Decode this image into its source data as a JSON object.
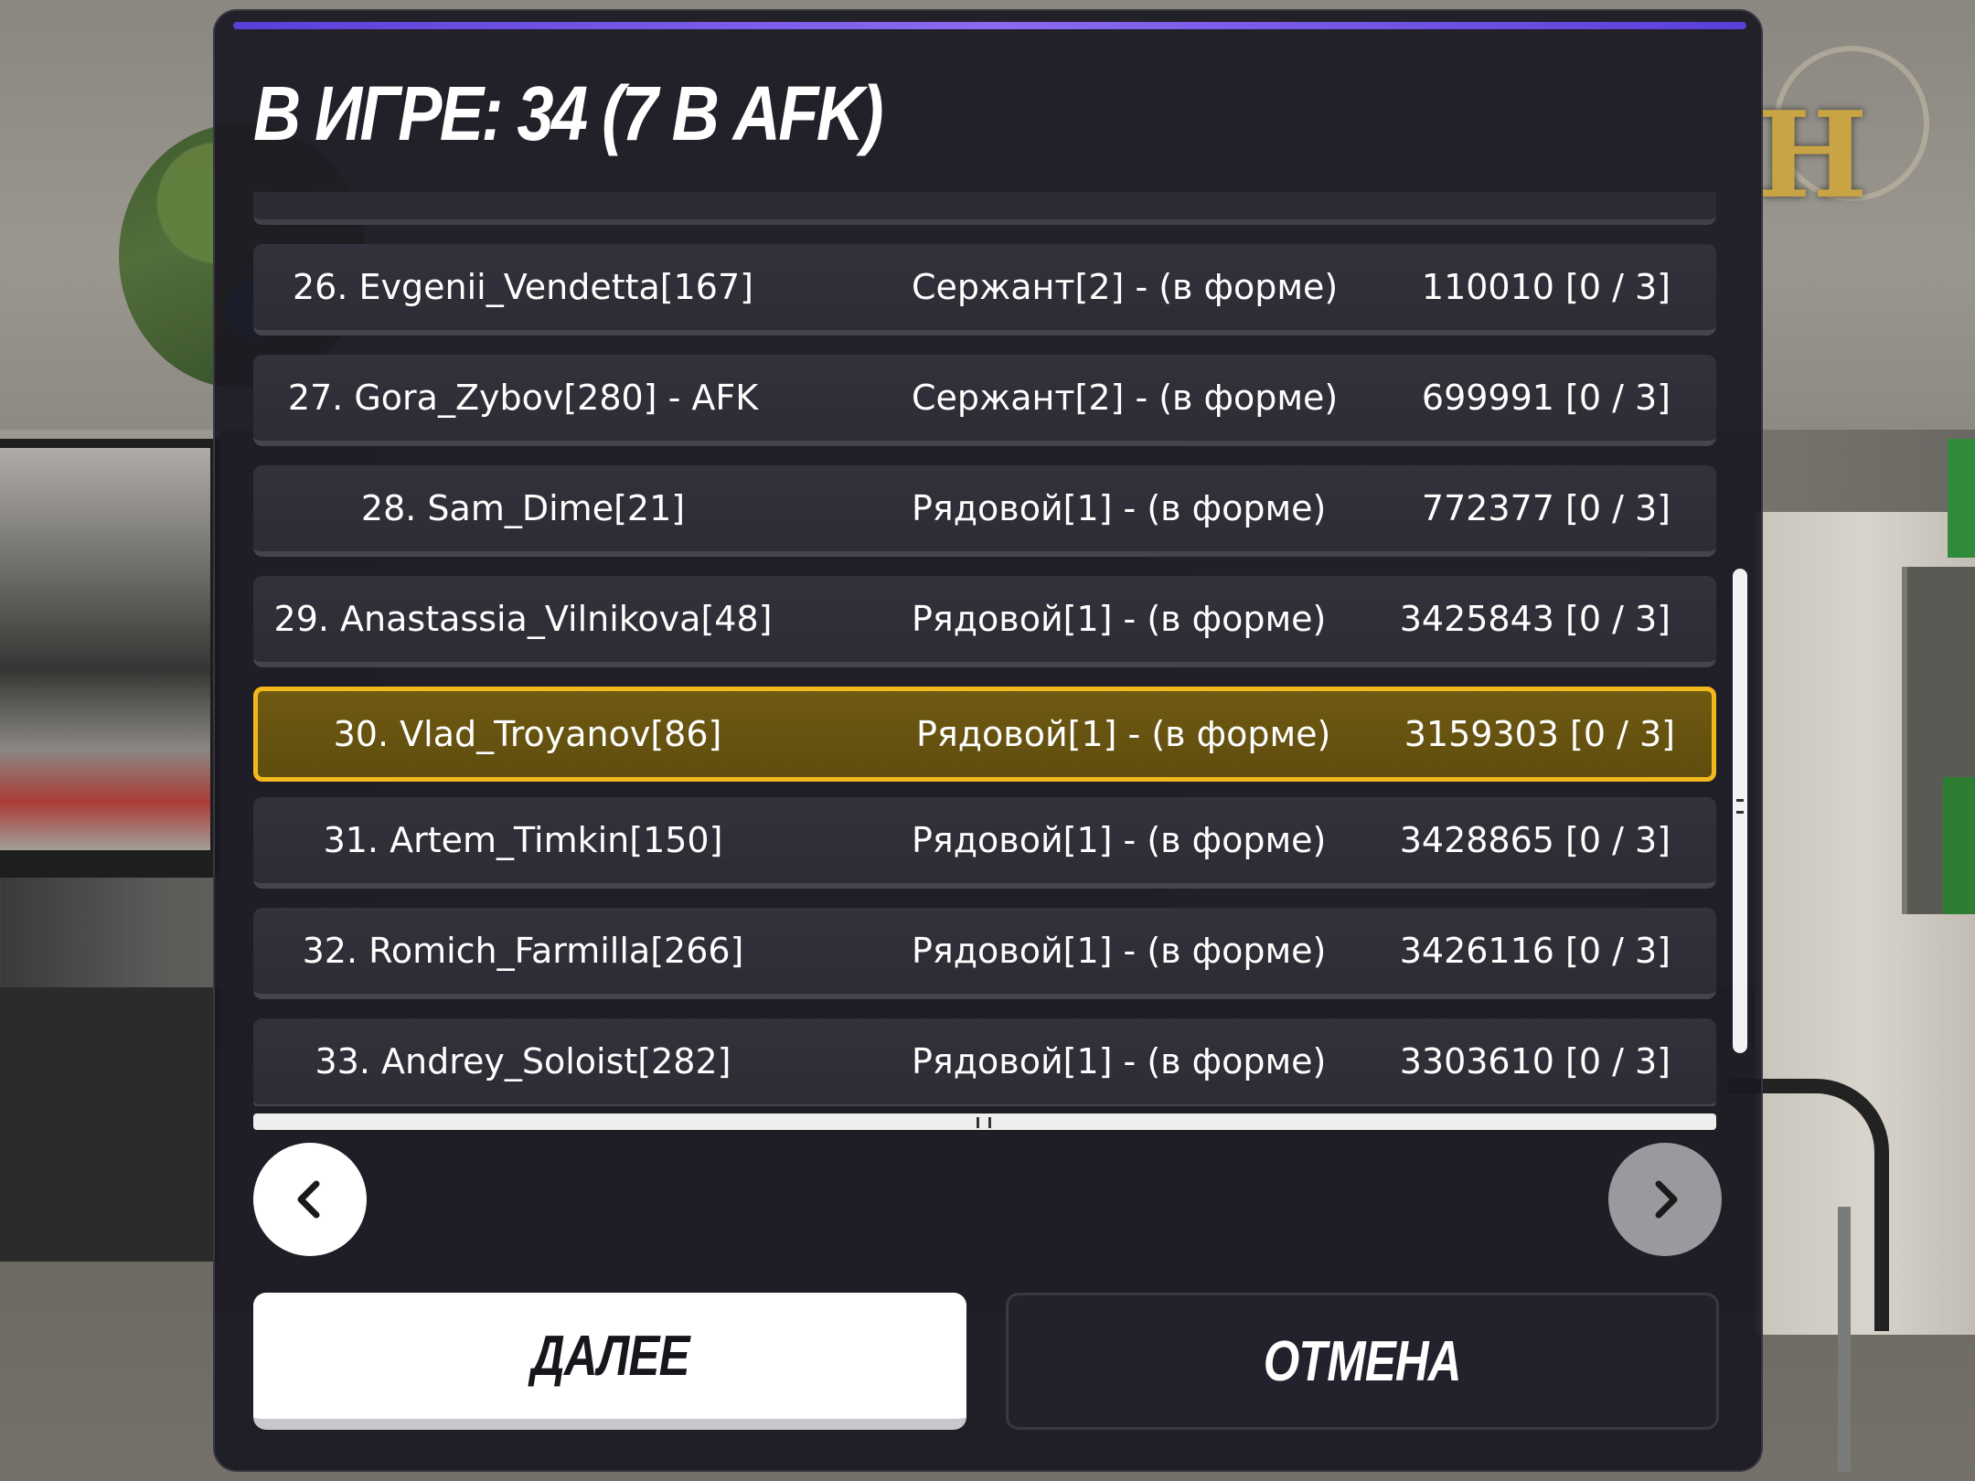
{
  "dialog": {
    "title": "В ИГРЕ: 34 (7 В AFK)"
  },
  "members": [
    {
      "name": "26. Evgenii_Vendetta[167]",
      "rank": "Сержант[2] - (в форме)",
      "stats": "110010 [0 / 3]",
      "selected": false
    },
    {
      "name": "27. Gora_Zybov[280] - AFK",
      "rank": "Сержант[2] - (в форме)",
      "stats": "699991 [0 / 3]",
      "selected": false
    },
    {
      "name": "28. Sam_Dime[21]",
      "rank": "Рядовой[1] - (в форме)",
      "stats": "772377 [0 / 3]",
      "selected": false
    },
    {
      "name": "29. Anastassia_Vilnikova[48]",
      "rank": "Рядовой[1] - (в форме)",
      "stats": "3425843 [0 / 3]",
      "selected": false
    },
    {
      "name": "30. Vlad_Troyanov[86]",
      "rank": "Рядовой[1] - (в форме)",
      "stats": "3159303 [0 / 3]",
      "selected": true
    },
    {
      "name": "31. Artem_Timkin[150]",
      "rank": "Рядовой[1] - (в форме)",
      "stats": "3428865 [0 / 3]",
      "selected": false
    },
    {
      "name": "32. Romich_Farmilla[266]",
      "rank": "Рядовой[1] - (в форме)",
      "stats": "3426116 [0 / 3]",
      "selected": false
    },
    {
      "name": "33. Andrey_Soloist[282]",
      "rank": "Рядовой[1] - (в форме)",
      "stats": "3303610 [0 / 3]",
      "selected": false
    }
  ],
  "buttons": {
    "prev_icon": "chevron-left-icon",
    "next_icon": "chevron-right-icon",
    "next_label": "ДАЛЕЕ",
    "cancel_label": "ОТМЕНА"
  },
  "colors": {
    "accent": "#7b5cf0",
    "selected_border": "#f2b81c",
    "selected_bg": "#665310"
  }
}
